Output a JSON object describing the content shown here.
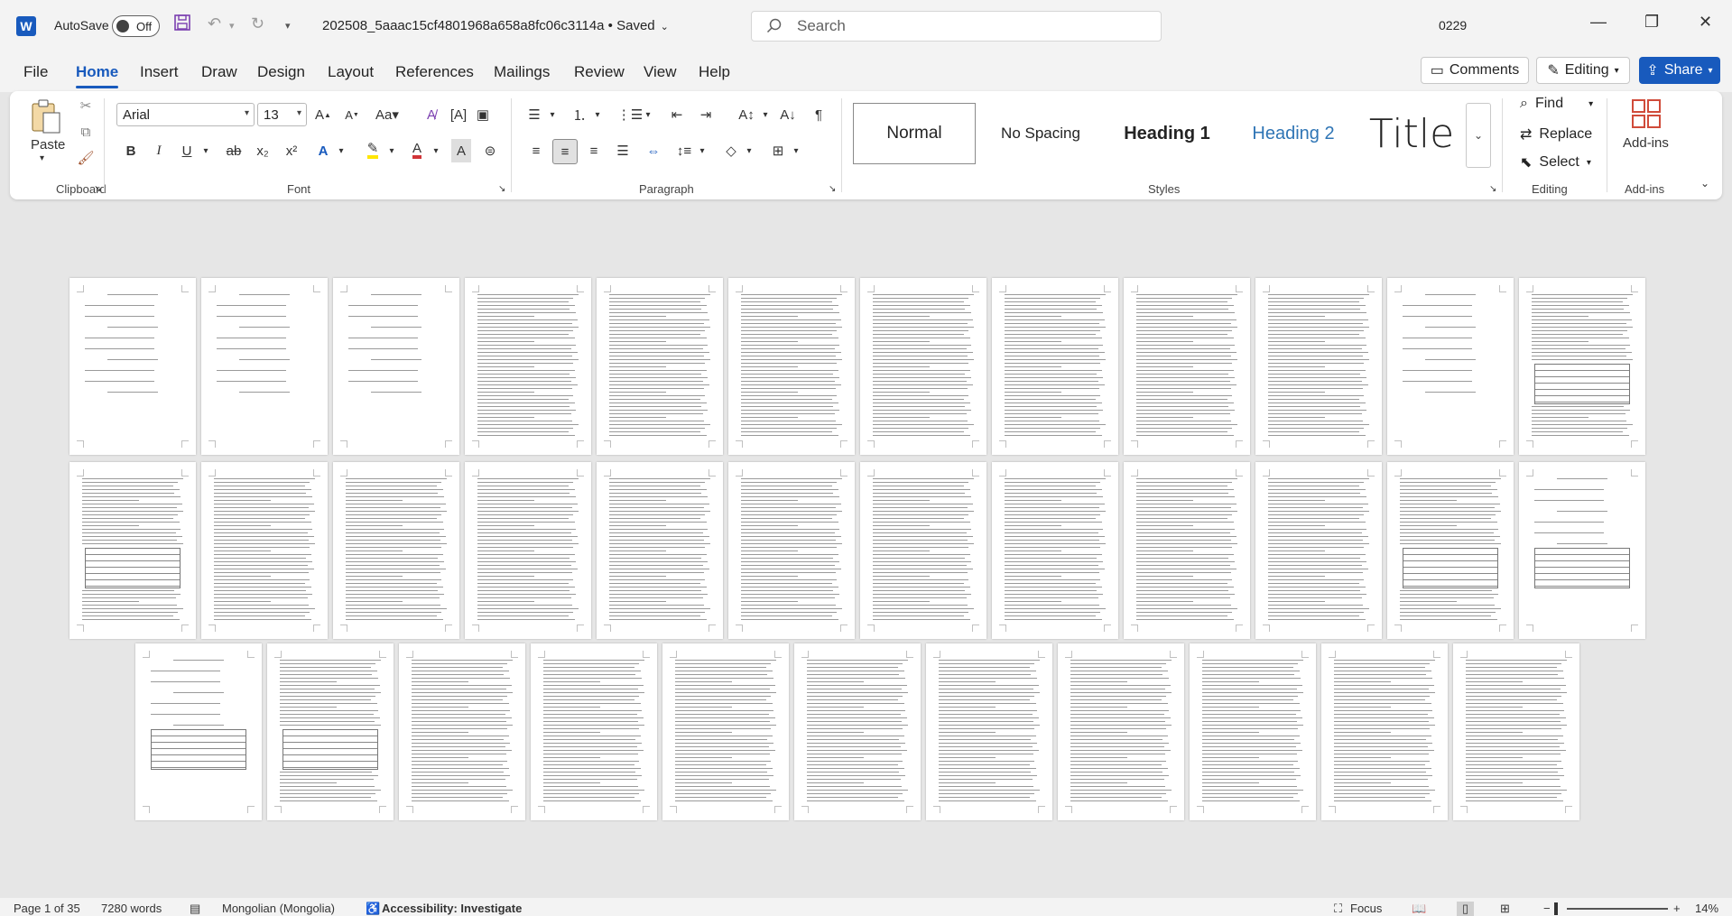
{
  "titlebar": {
    "app_letter": "W",
    "autosave_label": "AutoSave",
    "autosave_state": "Off",
    "doc_name": "202508_5aaac15cf4801968a658a8fc06c3114a • Saved",
    "search_placeholder": "Search",
    "user": "0229"
  },
  "menu": {
    "tabs": [
      "File",
      "Home",
      "Insert",
      "Draw",
      "Design",
      "Layout",
      "References",
      "Mailings",
      "Review",
      "View",
      "Help"
    ],
    "active": "Home",
    "comments": "Comments",
    "editing": "Editing",
    "share": "Share"
  },
  "ribbon": {
    "clipboard": {
      "paste": "Paste",
      "label": "Clipboard"
    },
    "font": {
      "family": "Arial",
      "size": "13",
      "label": "Font"
    },
    "paragraph": {
      "label": "Paragraph"
    },
    "styles": {
      "label": "Styles",
      "items": [
        "Normal",
        "No Spacing",
        "Heading 1",
        "Heading 2",
        "Title"
      ]
    },
    "editing": {
      "find": "Find",
      "replace": "Replace",
      "select": "Select",
      "label": "Editing"
    },
    "addins": {
      "button": "Add-ins",
      "label": "Add-ins"
    }
  },
  "status": {
    "page": "Page 1 of 35",
    "words": "7280 words",
    "language": "Mongolian (Mongolia)",
    "accessibility": "Accessibility: Investigate",
    "focus": "Focus",
    "zoom": "14%"
  },
  "colors": {
    "accent": "#185abd",
    "heading2": "#2f75b5",
    "highlight": "#ffe600",
    "font_color": "#d13438"
  }
}
